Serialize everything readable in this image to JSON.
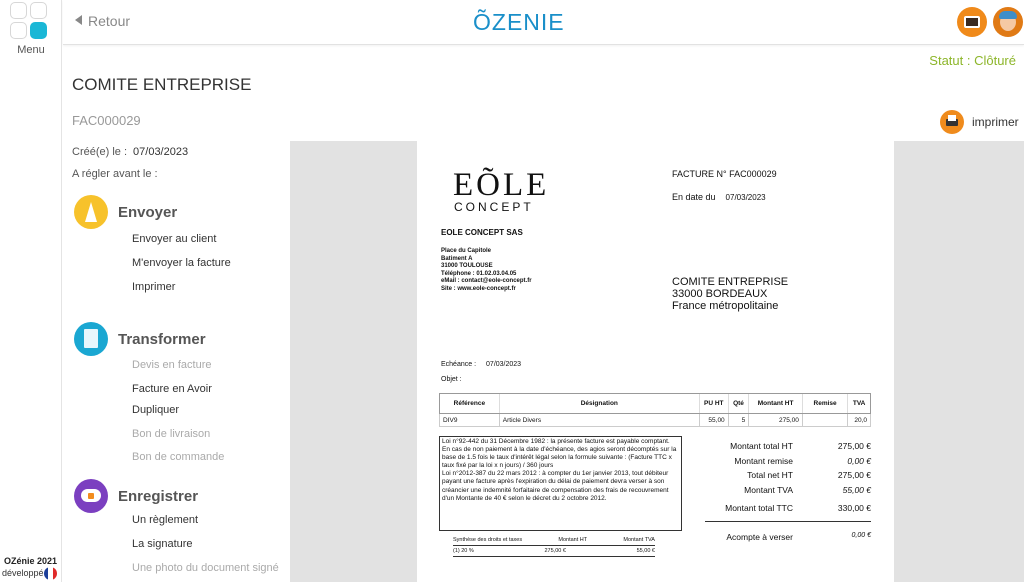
{
  "rail": {
    "menu_label": "Menu",
    "footer_year": "OZénie 2021",
    "footer_dev": "développé"
  },
  "header": {
    "back_label": "Retour",
    "logo_text": "ÕZENIE",
    "accent": "#1a8fc9"
  },
  "page": {
    "status": "Statut : Clôturé",
    "title": "COMITE ENTREPRISE",
    "ref": "FAC000029",
    "print_label": "imprimer",
    "created_label": "Créé(e) le :",
    "created_value": "07/03/2023",
    "due_label": "A régler avant le :"
  },
  "actions": {
    "send": {
      "title": "Envoyer",
      "items": [
        "Envoyer au client",
        "M'envoyer la facture",
        "Imprimer"
      ]
    },
    "transform": {
      "title": "Transformer",
      "items": [
        "Devis en facture",
        "Facture en Avoir",
        "Dupliquer",
        "Bon de livraison",
        "Bon de commande"
      ]
    },
    "save": {
      "title": "Enregistrer",
      "items": [
        "Un règlement",
        "La signature",
        "Une photo du document signé"
      ]
    }
  },
  "invoice": {
    "logo_main": "EÕLE",
    "logo_sub": "CONCEPT",
    "number": "FACTURE N° FAC000029",
    "date_label": "En date du",
    "date_value": "07/03/2023",
    "seller_name": "EOLE CONCEPT SAS",
    "seller_lines": [
      "Place du Capitole",
      "Batiment A",
      "31000  TOULOUSE",
      "Téléphone : 01.02.03.04.05",
      "eMail  : contact@eole-concept.fr",
      "Site  : www.eole-concept.fr"
    ],
    "client_lines": [
      "COMITE ENTREPRISE",
      "33000  BORDEAUX",
      "France métropolitaine"
    ],
    "due_label": "Echéance :",
    "due_value": "07/03/2023",
    "object_label": "Objet :",
    "columns": [
      "Référence",
      "Désignation",
      "PU HT",
      "Qté",
      "Montant HT",
      "Remise",
      "TVA"
    ],
    "rows": [
      [
        "DIV9",
        "Article Divers",
        "55,00",
        "5",
        "275,00",
        "",
        "20,0"
      ]
    ],
    "legal_text": "Loi n°92-442 du 31 Décembre 1982 : la présente facture est payable comptant. En cas de non paiement à la date d'échéance, des agios seront décomptés sur la base de 1.5 fois le taux d'intérêt légal selon la formule suivante :   (Facture TTC x taux fixé par la loi x n jours) / 360 jours\nLoi n°2012-387 du 22 mars 2012 : à compter du 1er janvier 2013, tout débiteur payant une facture après l'expiration du délai de paiement devra verser à son créancier une indemnité forfaitaire de compensation des frais de recouvrement d'un Montante de 40 € selon le décret du 2 octobre 2012.",
    "totals": [
      {
        "label": "Montant total HT",
        "value": "275,00 €",
        "italic": false
      },
      {
        "label": "Montant remise",
        "value": "0,00 €",
        "italic": true
      },
      {
        "label": "Total net HT",
        "value": "275,00 €",
        "italic": false
      },
      {
        "label": "Montant TVA",
        "value": "55,00 €",
        "italic": true
      }
    ],
    "ttc_label": "Montant total TTC",
    "ttc_value": "330,00 €",
    "acompte_label": "Acompte à verser",
    "acompte_value": "0,00 €",
    "synth_head": [
      "Synthèse des droits et taxes",
      "Montant HT",
      "Montant TVA"
    ],
    "synth_row": [
      "(1)   20 %",
      "275,00 €",
      "55,00 €"
    ]
  }
}
